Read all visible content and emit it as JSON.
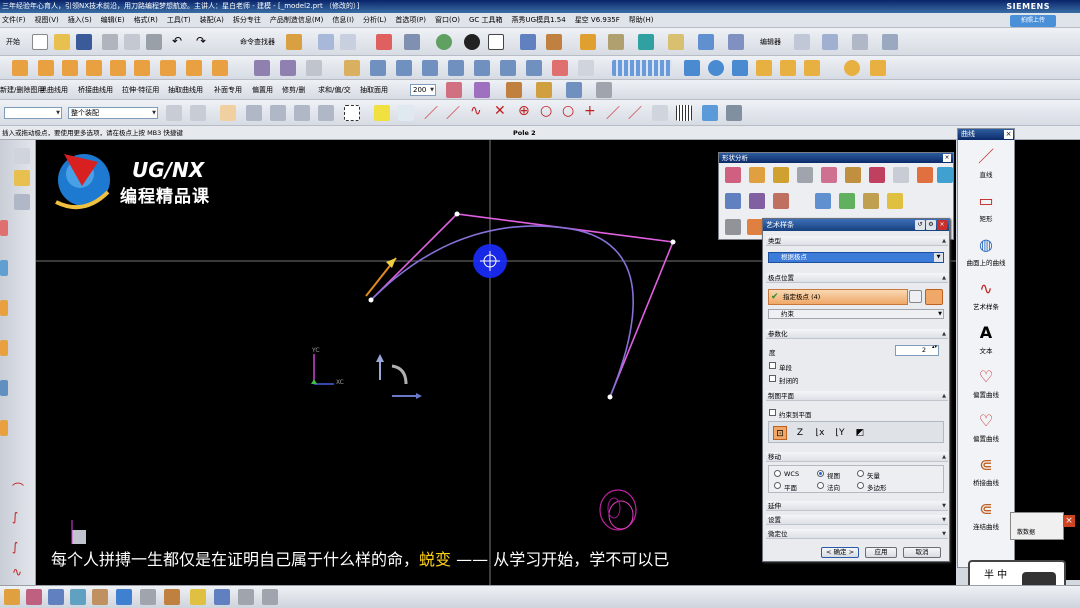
{
  "window": {
    "title": "三年经验年心育人，引领NX技术前沿，用刀路编程梦想航迹。主讲人：星白老师 - 建模 - [_model2.prt （修改的）]",
    "brand": "SIEMENS",
    "share_label": "拍照上传"
  },
  "menu": [
    "文件(F)",
    "视图(V)",
    "插入(S)",
    "编辑(E)",
    "格式(R)",
    "工具(T)",
    "装配(A)",
    "拆分专往",
    "产品制造信息(M)",
    "信息(I)",
    "分析(L)",
    "首选项(P)",
    "窗口(O)",
    "GC 工具箱",
    "燕秀UG模具1.54",
    "星空 V6.935F",
    "帮助(H)"
  ],
  "toolbar": {
    "start_label": "开始",
    "command_finder": "命令查找器",
    "edit_label": "编辑器",
    "row3_labels": [
      "新建/删除图用",
      "黑曲线用",
      "桥接曲线用",
      "拉伸·特征用",
      "抽取曲线用",
      "补面专用",
      "偏置用",
      "修剪/删",
      "求和/偏/交",
      "抽取面用"
    ],
    "zoom_value": "200",
    "assembly_filter": "整个装配"
  },
  "status": {
    "prompt": "插入或拖动极点，要使用更多选项，请在极点上按 MB3 快捷键",
    "pole": "Pole 2"
  },
  "logo": {
    "title": "UG/NX",
    "subtitle": "编程精品课"
  },
  "axes": {
    "x": "XC",
    "y": "YC"
  },
  "subtitle": {
    "before": "每个人拼搏一生都仅是在证明自己属于什么样的命，",
    "highlight": "蜕变",
    "after": " —— 从学习开始，学不可以已"
  },
  "curve_palette": {
    "title": "曲线",
    "items": [
      "直线",
      "矩形",
      "曲面上的曲线",
      "艺术样条",
      "文本",
      "偏置曲线",
      "偏置曲线",
      "桥接曲线",
      "连结曲线"
    ]
  },
  "shape_analysis": {
    "title": "形状分析"
  },
  "dialog": {
    "title": "艺术样条",
    "type_section": "类型",
    "type_value": "根据极点",
    "pole_section": "极点位置",
    "pole_value": "指定极点 (4)",
    "constraint_value": "约束",
    "param_section": "参数化",
    "degree_label": "度",
    "degree_value": "2",
    "single_segment": "单段",
    "closed": "封闭的",
    "plane_section": "制图平面",
    "constrain_to_plane": "约束到平面",
    "move_section": "移动",
    "move_options": [
      "WCS",
      "视图",
      "矢量",
      "平面",
      "法向",
      "多边形"
    ],
    "extend_section": "延伸",
    "settings_section": "设置",
    "micro_section": "微定位",
    "ok": "< 确定 >",
    "apply": "应用",
    "cancel": "取消"
  },
  "notify": {
    "text": "散数据"
  },
  "avatar": {
    "text": "半 中"
  },
  "chart_data": {
    "type": "line",
    "series": [
      {
        "name": "control polygon",
        "x": [
          0,
          86,
          302,
          239
        ],
        "y": [
          0,
          86,
          58,
          -97
        ]
      },
      {
        "name": "spline",
        "x": [
          0,
          120,
          302
        ],
        "y": [
          0,
          37,
          58
        ]
      }
    ]
  }
}
